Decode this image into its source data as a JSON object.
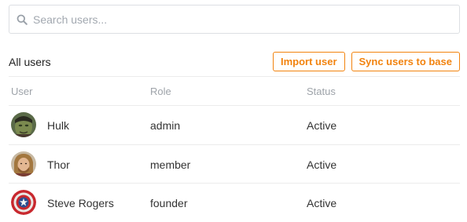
{
  "search": {
    "placeholder": "Search users...",
    "value": ""
  },
  "section": {
    "title": "All users",
    "import_label": "Import user",
    "sync_label": "Sync users to base"
  },
  "table": {
    "columns": [
      "User",
      "Role",
      "Status"
    ],
    "rows": [
      {
        "name": "Hulk",
        "role": "admin",
        "status": "Active",
        "avatar": "hulk-avatar"
      },
      {
        "name": "Thor",
        "role": "member",
        "status": "Active",
        "avatar": "thor-avatar"
      },
      {
        "name": "Steve Rogers",
        "role": "founder",
        "status": "Active",
        "avatar": "captain-america-shield-avatar"
      }
    ]
  },
  "colors": {
    "accent": "#f2830e",
    "border": "#dcdfe3",
    "header_text": "#9ea3a9"
  }
}
